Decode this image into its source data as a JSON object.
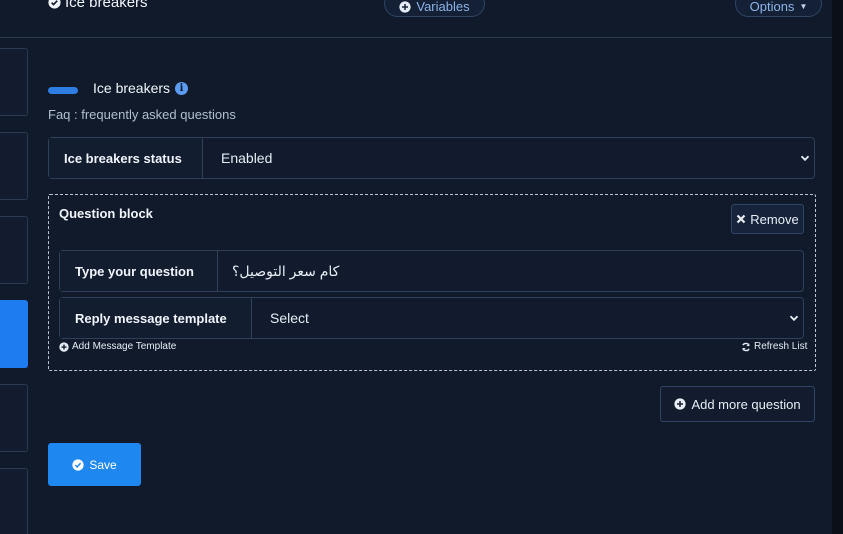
{
  "header": {
    "title": "Ice breakers",
    "variables_label": "Variables",
    "options_label": "Options"
  },
  "section": {
    "title": "Ice breakers",
    "subtitle": "Faq : frequently asked questions"
  },
  "status": {
    "label": "Ice breakers status",
    "value": "Enabled"
  },
  "question_block": {
    "title": "Question block",
    "remove_label": "Remove",
    "question_label": "Type your question",
    "question_value": "كام سعر التوصيل؟",
    "template_label": "Reply message template",
    "template_value": "Select",
    "add_template_label": "Add Message Template",
    "refresh_label": "Refresh List"
  },
  "actions": {
    "add_more_label": "Add more question",
    "save_label": "Save"
  },
  "colors": {
    "background": "#101a2b",
    "accent": "#1e88f0"
  }
}
